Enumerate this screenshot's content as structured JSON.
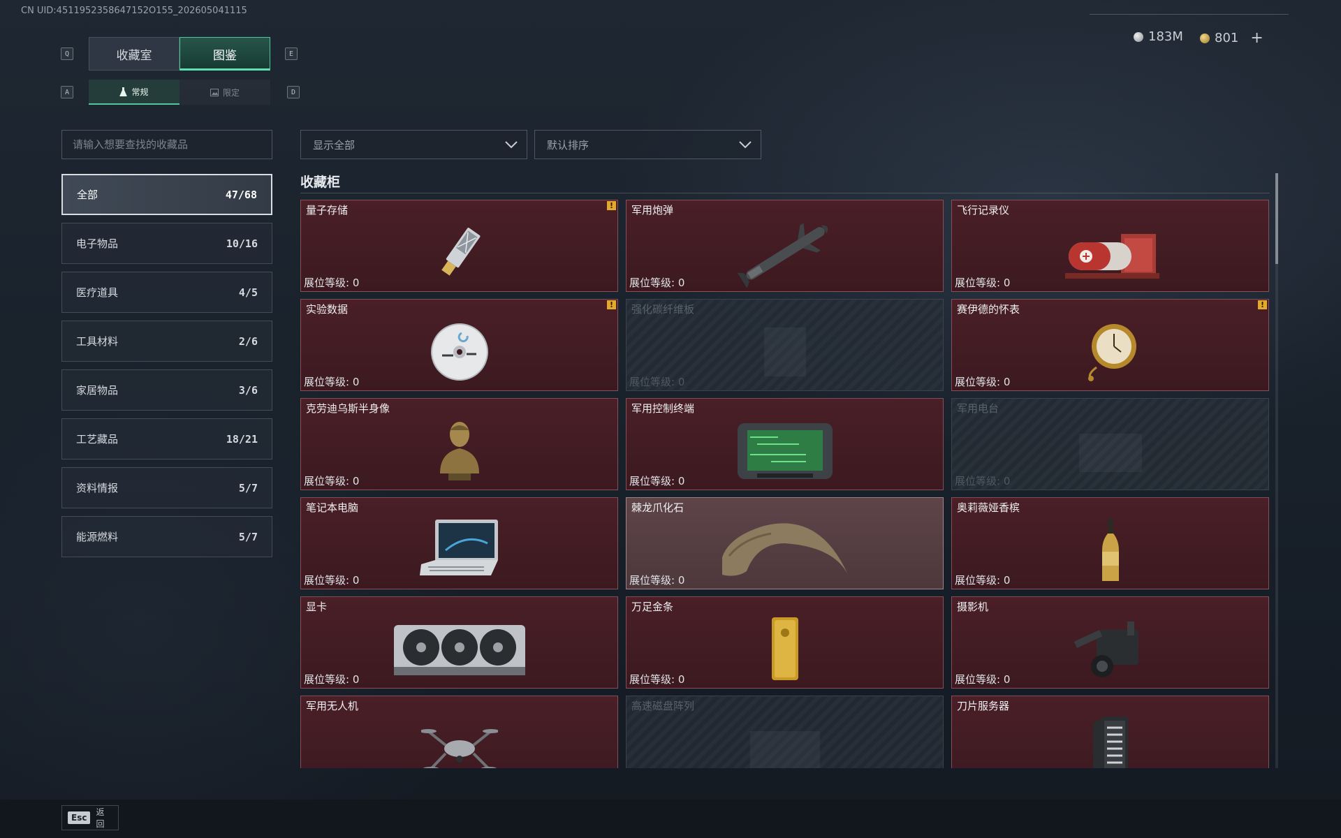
{
  "uid_text": "CN UID:4511952358647152O155_202605041115",
  "currency": {
    "silver": "183M",
    "gold": "801",
    "plus": "+"
  },
  "tabs": {
    "left_key": "Q",
    "right_key": "E",
    "items": [
      {
        "label": "收藏室"
      },
      {
        "label": "图鉴",
        "active": true
      }
    ]
  },
  "subtabs": {
    "left_key": "A",
    "right_key": "D",
    "items": [
      {
        "label": "常规",
        "active": true
      },
      {
        "label": "限定"
      }
    ]
  },
  "search": {
    "placeholder": "请输入想要查找的收藏品"
  },
  "filter": {
    "label": "显示全部"
  },
  "sort": {
    "label": "默认排序"
  },
  "categories": [
    {
      "label": "全部",
      "count": "47/68",
      "active": true
    },
    {
      "label": "电子物品",
      "count": "10/16"
    },
    {
      "label": "医疗道具",
      "count": "4/5"
    },
    {
      "label": "工具材料",
      "count": "2/6"
    },
    {
      "label": "家居物品",
      "count": "3/6"
    },
    {
      "label": "工艺藏品",
      "count": "18/21"
    },
    {
      "label": "资料情报",
      "count": "5/7"
    },
    {
      "label": "能源燃料",
      "count": "5/7"
    }
  ],
  "section_title": "收藏柜",
  "level_label": "展位等级: 0",
  "items": [
    {
      "name": "量子存储",
      "state": "owned",
      "warn": true,
      "icon": "usb-drive-icon"
    },
    {
      "name": "军用炮弹",
      "state": "owned",
      "icon": "missile-icon"
    },
    {
      "name": "飞行记录仪",
      "state": "owned",
      "icon": "flight-recorder-icon"
    },
    {
      "name": "实验数据",
      "state": "owned",
      "warn": true,
      "icon": "disc-icon"
    },
    {
      "name": "强化碳纤维板",
      "state": "locked",
      "icon": "carbon-plate-icon"
    },
    {
      "name": "赛伊德的怀表",
      "state": "owned",
      "warn": true,
      "icon": "pocket-watch-icon"
    },
    {
      "name": "克劳迪乌斯半身像",
      "state": "owned",
      "icon": "bust-icon"
    },
    {
      "name": "军用控制终端",
      "state": "owned",
      "icon": "control-terminal-icon"
    },
    {
      "name": "军用电台",
      "state": "locked",
      "icon": "radio-icon"
    },
    {
      "name": "笔记本电脑",
      "state": "owned",
      "icon": "laptop-icon"
    },
    {
      "name": "棘龙爪化石",
      "state": "highlight",
      "icon": "claw-fossil-icon"
    },
    {
      "name": "奥莉薇娅香槟",
      "state": "owned",
      "icon": "champagne-icon"
    },
    {
      "name": "显卡",
      "state": "owned",
      "icon": "gpu-icon"
    },
    {
      "name": "万足金条",
      "state": "owned",
      "icon": "gold-bar-icon"
    },
    {
      "name": "摄影机",
      "state": "owned",
      "icon": "camera-icon"
    },
    {
      "name": "军用无人机",
      "state": "owned",
      "icon": "drone-icon"
    },
    {
      "name": "高速磁盘阵列",
      "state": "locked",
      "icon": "disk-array-icon"
    },
    {
      "name": "刀片服务器",
      "state": "owned",
      "icon": "blade-server-icon"
    }
  ],
  "esc": {
    "key": "Esc",
    "label": "返回"
  },
  "colors": {
    "accent": "#4fc99a",
    "card_bg": "#4a1f27",
    "warn": "#e2a92b"
  }
}
